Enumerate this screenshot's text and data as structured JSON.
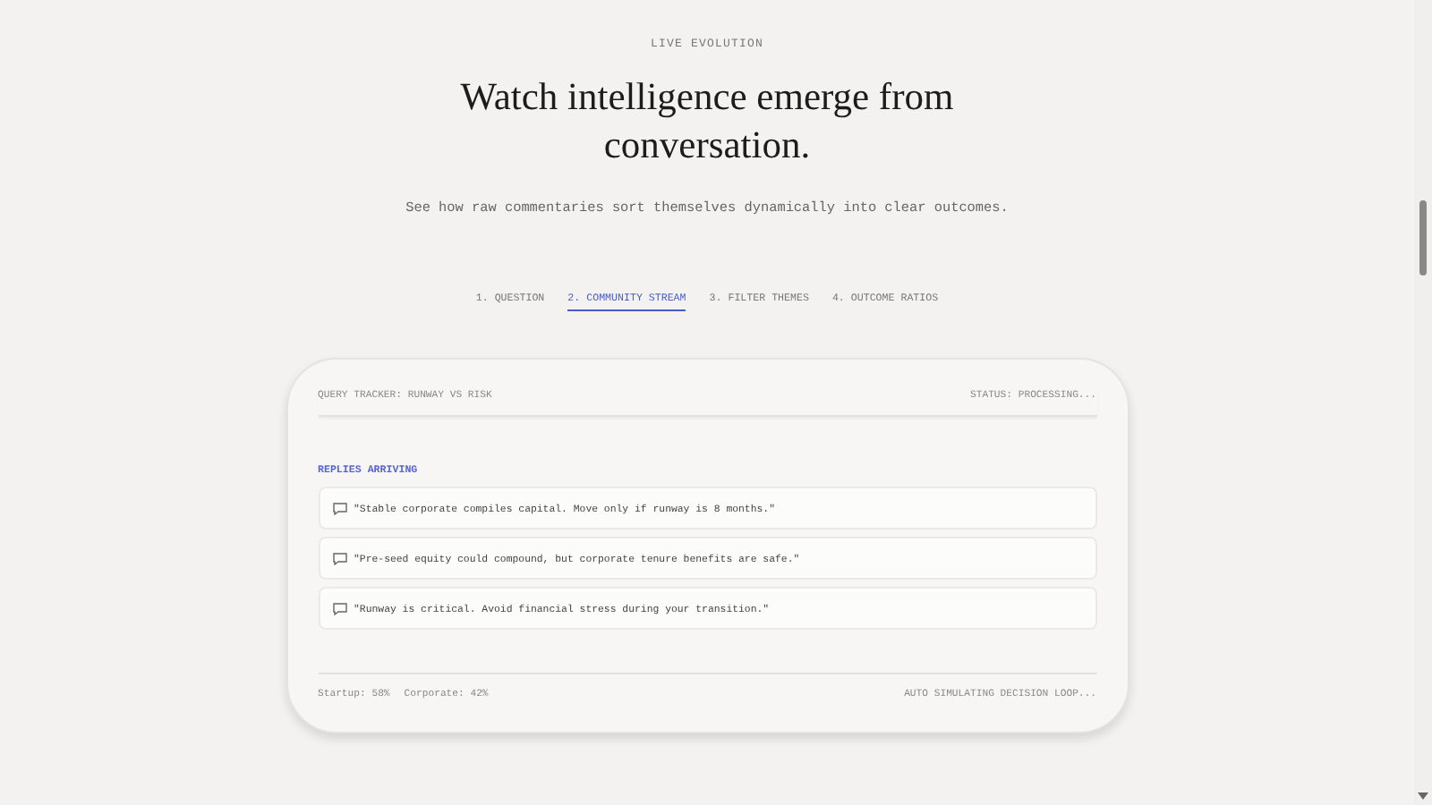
{
  "eyebrow": "LIVE EVOLUTION",
  "title": "Watch intelligence emerge from conversation.",
  "subtitle": "See how raw commentaries sort themselves dynamically into clear outcomes.",
  "tabs": [
    {
      "label": "1. QUESTION",
      "selected": false
    },
    {
      "label": "2. COMMUNITY STREAM",
      "selected": true
    },
    {
      "label": "3. FILTER THEMES",
      "selected": false
    },
    {
      "label": "4. OUTCOME RATIOS",
      "selected": false
    }
  ],
  "card": {
    "tracker": "QUERY TRACKER: RUNWAY VS RISK",
    "status": "STATUS: PROCESSING...",
    "section_label": "REPLIES ARRIVING",
    "replies": [
      "\"Stable corporate compiles capital. Move only if runway is 8 months.\"",
      "\"Pre-seed equity could compound, but corporate tenure benefits are safe.\"",
      "\"Runway is critical. Avoid financial stress during your transition.\""
    ],
    "ratios": [
      "Startup: 58%",
      "Corporate: 42%"
    ],
    "loop": "AUTO SIMULATING DECISION LOOP..."
  }
}
